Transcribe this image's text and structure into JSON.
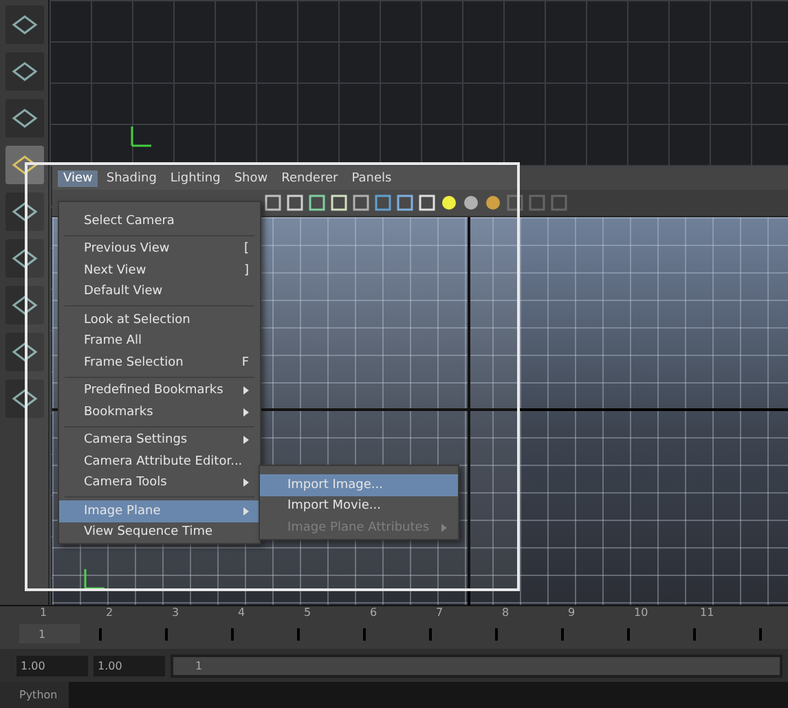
{
  "panel_menu": [
    {
      "label": "View",
      "selected": true
    },
    {
      "label": "Shading",
      "selected": false
    },
    {
      "label": "Lighting",
      "selected": false
    },
    {
      "label": "Show",
      "selected": false
    },
    {
      "label": "Renderer",
      "selected": false
    },
    {
      "label": "Panels",
      "selected": false
    }
  ],
  "view_menu": {
    "sections": [
      [
        {
          "label": "Select Camera",
          "submenu": false,
          "selected": false
        }
      ],
      [
        {
          "label": "Previous View",
          "shortcut": "[",
          "submenu": false,
          "selected": false
        },
        {
          "label": "Next View",
          "shortcut": "]",
          "submenu": false,
          "selected": false
        },
        {
          "label": "Default View",
          "submenu": false,
          "selected": false
        }
      ],
      [
        {
          "label": "Look at Selection",
          "submenu": false,
          "selected": false
        },
        {
          "label": "Frame All",
          "submenu": false,
          "selected": false
        },
        {
          "label": "Frame Selection",
          "shortcut": "F",
          "submenu": false,
          "selected": false
        }
      ],
      [
        {
          "label": "Predefined Bookmarks",
          "submenu": true,
          "selected": false
        },
        {
          "label": "Bookmarks",
          "submenu": true,
          "selected": false
        }
      ],
      [
        {
          "label": "Camera Settings",
          "submenu": true,
          "selected": false
        },
        {
          "label": "Camera Attribute Editor...",
          "submenu": false,
          "selected": false
        },
        {
          "label": "Camera Tools",
          "submenu": true,
          "selected": false
        }
      ],
      [
        {
          "label": "Image Plane",
          "submenu": true,
          "selected": true
        },
        {
          "label": "View Sequence Time",
          "submenu": false,
          "selected": false
        }
      ]
    ]
  },
  "image_plane_menu": {
    "items": [
      {
        "label": "Import Image...",
        "selected": true,
        "disabled": false,
        "submenu": false
      },
      {
        "label": "Import Movie...",
        "selected": false,
        "disabled": false,
        "submenu": false
      },
      {
        "label": "Image Plane Attributes",
        "selected": false,
        "disabled": true,
        "submenu": true
      }
    ]
  },
  "time_slider": {
    "ticks": [
      "1",
      "2",
      "3",
      "4",
      "5",
      "6",
      "7",
      "8",
      "9",
      "10",
      "11"
    ],
    "current_frame": "1",
    "level": 0
  },
  "range_slider": {
    "start_time": "1.00",
    "range_start": "1.00",
    "range_value": "1",
    "level": 1
  },
  "command_line": {
    "language": "Python"
  }
}
